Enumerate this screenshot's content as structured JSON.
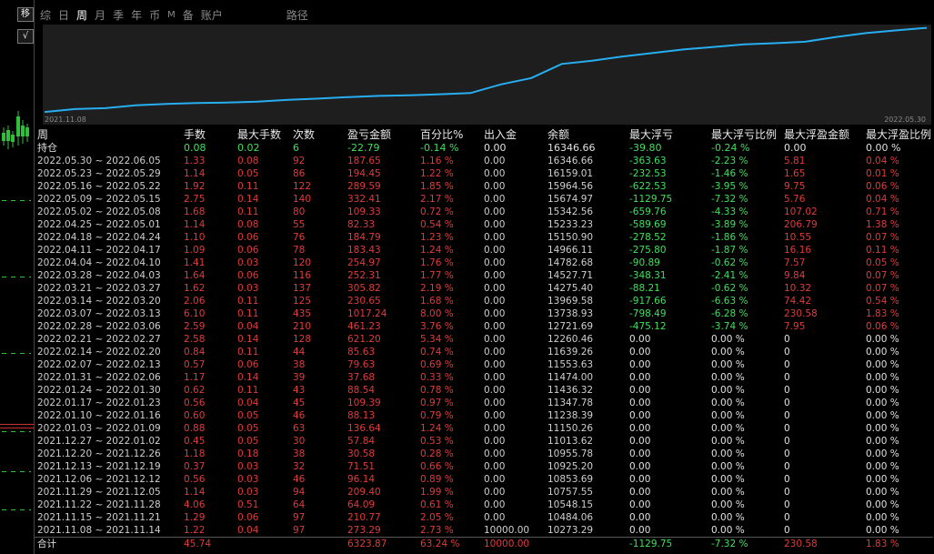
{
  "left_buttons": {
    "move": "移",
    "check": "√"
  },
  "tabs": [
    {
      "label": "综",
      "active": false,
      "small": false
    },
    {
      "label": "日",
      "active": false,
      "small": false
    },
    {
      "label": "周",
      "active": true,
      "small": false
    },
    {
      "label": "月",
      "active": false,
      "small": false
    },
    {
      "label": "季",
      "active": false,
      "small": false
    },
    {
      "label": "年",
      "active": false,
      "small": false
    },
    {
      "label": "币",
      "active": false,
      "small": false
    },
    {
      "label": "M",
      "active": false,
      "small": true
    },
    {
      "label": "备",
      "active": false,
      "small": false
    },
    {
      "label": "账户",
      "active": false,
      "small": false
    },
    {
      "label": "路径",
      "active": false,
      "small": false
    }
  ],
  "colors": {
    "positive": "#3ee05a",
    "negative": "#e23a3a",
    "line": "#27aef0",
    "panel": "#1e1e1e"
  },
  "chart_data": {
    "type": "line",
    "x_start_label": "2021.11.08",
    "x_end_label": "2022.05.30",
    "series": [
      {
        "values": [
          10273.29,
          10484.06,
          10548.15,
          10757.55,
          10853.69,
          10925.2,
          10955.78,
          11013.62,
          11150.26,
          11238.39,
          11347.78,
          11436.32,
          11474.0,
          11553.63,
          11639.26,
          12260.46,
          12721.69,
          13738.93,
          13969.58,
          14275.4,
          14527.71,
          14782.68,
          14966.11,
          15150.9,
          15233.23,
          15342.56,
          15674.97,
          15964.56,
          16159.01,
          16346.66
        ]
      }
    ],
    "ylim": [
      10150,
      16450
    ]
  },
  "table": {
    "headers": [
      "周",
      "手数",
      "最大手数",
      "次数",
      "盈亏金额",
      "百分比%",
      "出入金",
      "余额",
      "最大浮亏",
      "最大浮亏比例",
      "最大浮盈金额",
      "最大浮盈比例"
    ],
    "hold": {
      "label": "持仓",
      "lots": "0.08",
      "max_lots": "0.02",
      "count": "6",
      "pnl": "-22.79",
      "pct": "-0.14 %",
      "flow": "0.00",
      "balance": "16346.66",
      "max_dd": "-39.80",
      "max_dd_pct": "-0.24 %",
      "max_fp": "0.00",
      "max_fp_pct": "0.00 %"
    },
    "rows": [
      {
        "week": "2022.05.30 ~ 2022.06.05",
        "lots": "1.33",
        "max_lots": "0.08",
        "count": "92",
        "pnl": "187.65",
        "pct": "1.16 %",
        "flow": "0.00",
        "balance": "16346.66",
        "max_dd": "-363.63",
        "max_dd_pct": "-2.23 %",
        "max_fp": "5.81",
        "max_fp_pct": "0.04 %"
      },
      {
        "week": "2022.05.23 ~ 2022.05.29",
        "lots": "1.14",
        "max_lots": "0.05",
        "count": "86",
        "pnl": "194.45",
        "pct": "1.22 %",
        "flow": "0.00",
        "balance": "16159.01",
        "max_dd": "-232.53",
        "max_dd_pct": "-1.46 %",
        "max_fp": "1.65",
        "max_fp_pct": "0.01 %"
      },
      {
        "week": "2022.05.16 ~ 2022.05.22",
        "lots": "1.92",
        "max_lots": "0.11",
        "count": "122",
        "pnl": "289.59",
        "pct": "1.85 %",
        "flow": "0.00",
        "balance": "15964.56",
        "max_dd": "-622.53",
        "max_dd_pct": "-3.95 %",
        "max_fp": "9.75",
        "max_fp_pct": "0.06 %"
      },
      {
        "week": "2022.05.09 ~ 2022.05.15",
        "lots": "2.75",
        "max_lots": "0.14",
        "count": "140",
        "pnl": "332.41",
        "pct": "2.17 %",
        "flow": "0.00",
        "balance": "15674.97",
        "max_dd": "-1129.75",
        "max_dd_pct": "-7.32 %",
        "max_fp": "5.76",
        "max_fp_pct": "0.04 %"
      },
      {
        "week": "2022.05.02 ~ 2022.05.08",
        "lots": "1.68",
        "max_lots": "0.11",
        "count": "80",
        "pnl": "109.33",
        "pct": "0.72 %",
        "flow": "0.00",
        "balance": "15342.56",
        "max_dd": "-659.76",
        "max_dd_pct": "-4.33 %",
        "max_fp": "107.02",
        "max_fp_pct": "0.71 %"
      },
      {
        "week": "2022.04.25 ~ 2022.05.01",
        "lots": "1.14",
        "max_lots": "0.08",
        "count": "55",
        "pnl": "82.33",
        "pct": "0.54 %",
        "flow": "0.00",
        "balance": "15233.23",
        "max_dd": "-589.69",
        "max_dd_pct": "-3.89 %",
        "max_fp": "206.79",
        "max_fp_pct": "1.38 %"
      },
      {
        "week": "2022.04.18 ~ 2022.04.24",
        "lots": "1.10",
        "max_lots": "0.06",
        "count": "76",
        "pnl": "184.79",
        "pct": "1.23 %",
        "flow": "0.00",
        "balance": "15150.90",
        "max_dd": "-278.52",
        "max_dd_pct": "-1.86 %",
        "max_fp": "10.55",
        "max_fp_pct": "0.07 %"
      },
      {
        "week": "2022.04.11 ~ 2022.04.17",
        "lots": "1.09",
        "max_lots": "0.06",
        "count": "78",
        "pnl": "183.43",
        "pct": "1.24 %",
        "flow": "0.00",
        "balance": "14966.11",
        "max_dd": "-275.80",
        "max_dd_pct": "-1.87 %",
        "max_fp": "16.16",
        "max_fp_pct": "0.11 %"
      },
      {
        "week": "2022.04.04 ~ 2022.04.10",
        "lots": "1.41",
        "max_lots": "0.03",
        "count": "120",
        "pnl": "254.97",
        "pct": "1.76 %",
        "flow": "0.00",
        "balance": "14782.68",
        "max_dd": "-90.89",
        "max_dd_pct": "-0.62 %",
        "max_fp": "7.57",
        "max_fp_pct": "0.05 %"
      },
      {
        "week": "2022.03.28 ~ 2022.04.03",
        "lots": "1.64",
        "max_lots": "0.06",
        "count": "116",
        "pnl": "252.31",
        "pct": "1.77 %",
        "flow": "0.00",
        "balance": "14527.71",
        "max_dd": "-348.31",
        "max_dd_pct": "-2.41 %",
        "max_fp": "9.84",
        "max_fp_pct": "0.07 %"
      },
      {
        "week": "2022.03.21 ~ 2022.03.27",
        "lots": "1.62",
        "max_lots": "0.03",
        "count": "137",
        "pnl": "305.82",
        "pct": "2.19 %",
        "flow": "0.00",
        "balance": "14275.40",
        "max_dd": "-88.21",
        "max_dd_pct": "-0.62 %",
        "max_fp": "10.32",
        "max_fp_pct": "0.07 %"
      },
      {
        "week": "2022.03.14 ~ 2022.03.20",
        "lots": "2.06",
        "max_lots": "0.11",
        "count": "125",
        "pnl": "230.65",
        "pct": "1.68 %",
        "flow": "0.00",
        "balance": "13969.58",
        "max_dd": "-917.66",
        "max_dd_pct": "-6.63 %",
        "max_fp": "74.42",
        "max_fp_pct": "0.54 %"
      },
      {
        "week": "2022.03.07 ~ 2022.03.13",
        "lots": "6.10",
        "max_lots": "0.11",
        "count": "435",
        "pnl": "1017.24",
        "pct": "8.00 %",
        "flow": "0.00",
        "balance": "13738.93",
        "max_dd": "-798.49",
        "max_dd_pct": "-6.28 %",
        "max_fp": "230.58",
        "max_fp_pct": "1.83 %"
      },
      {
        "week": "2022.02.28 ~ 2022.03.06",
        "lots": "2.59",
        "max_lots": "0.04",
        "count": "210",
        "pnl": "461.23",
        "pct": "3.76 %",
        "flow": "0.00",
        "balance": "12721.69",
        "max_dd": "-475.12",
        "max_dd_pct": "-3.74 %",
        "max_fp": "7.95",
        "max_fp_pct": "0.06 %"
      },
      {
        "week": "2022.02.21 ~ 2022.02.27",
        "lots": "2.58",
        "max_lots": "0.14",
        "count": "128",
        "pnl": "621.20",
        "pct": "5.34 %",
        "flow": "0.00",
        "balance": "12260.46",
        "max_dd": "0.00",
        "max_dd_pct": "0.00 %",
        "max_fp": "0",
        "max_fp_pct": "0.00 %"
      },
      {
        "week": "2022.02.14 ~ 2022.02.20",
        "lots": "0.84",
        "max_lots": "0.11",
        "count": "44",
        "pnl": "85.63",
        "pct": "0.74 %",
        "flow": "0.00",
        "balance": "11639.26",
        "max_dd": "0.00",
        "max_dd_pct": "0.00 %",
        "max_fp": "0",
        "max_fp_pct": "0.00 %"
      },
      {
        "week": "2022.02.07 ~ 2022.02.13",
        "lots": "0.57",
        "max_lots": "0.06",
        "count": "38",
        "pnl": "79.63",
        "pct": "0.69 %",
        "flow": "0.00",
        "balance": "11553.63",
        "max_dd": "0.00",
        "max_dd_pct": "0.00 %",
        "max_fp": "0",
        "max_fp_pct": "0.00 %"
      },
      {
        "week": "2022.01.31 ~ 2022.02.06",
        "lots": "1.17",
        "max_lots": "0.14",
        "count": "39",
        "pnl": "37.68",
        "pct": "0.33 %",
        "flow": "0.00",
        "balance": "11474.00",
        "max_dd": "0.00",
        "max_dd_pct": "0.00 %",
        "max_fp": "0",
        "max_fp_pct": "0.00 %"
      },
      {
        "week": "2022.01.24 ~ 2022.01.30",
        "lots": "0.62",
        "max_lots": "0.11",
        "count": "43",
        "pnl": "88.54",
        "pct": "0.78 %",
        "flow": "0.00",
        "balance": "11436.32",
        "max_dd": "0.00",
        "max_dd_pct": "0.00 %",
        "max_fp": "0",
        "max_fp_pct": "0.00 %"
      },
      {
        "week": "2022.01.17 ~ 2022.01.23",
        "lots": "0.56",
        "max_lots": "0.04",
        "count": "45",
        "pnl": "109.39",
        "pct": "0.97 %",
        "flow": "0.00",
        "balance": "11347.78",
        "max_dd": "0.00",
        "max_dd_pct": "0.00 %",
        "max_fp": "0",
        "max_fp_pct": "0.00 %"
      },
      {
        "week": "2022.01.10 ~ 2022.01.16",
        "lots": "0.60",
        "max_lots": "0.05",
        "count": "46",
        "pnl": "88.13",
        "pct": "0.79 %",
        "flow": "0.00",
        "balance": "11238.39",
        "max_dd": "0.00",
        "max_dd_pct": "0.00 %",
        "max_fp": "0",
        "max_fp_pct": "0.00 %"
      },
      {
        "week": "2022.01.03 ~ 2022.01.09",
        "lots": "0.88",
        "max_lots": "0.05",
        "count": "63",
        "pnl": "136.64",
        "pct": "1.24 %",
        "flow": "0.00",
        "balance": "11150.26",
        "max_dd": "0.00",
        "max_dd_pct": "0.00 %",
        "max_fp": "0",
        "max_fp_pct": "0.00 %"
      },
      {
        "week": "2021.12.27 ~ 2022.01.02",
        "lots": "0.45",
        "max_lots": "0.05",
        "count": "30",
        "pnl": "57.84",
        "pct": "0.53 %",
        "flow": "0.00",
        "balance": "11013.62",
        "max_dd": "0.00",
        "max_dd_pct": "0.00 %",
        "max_fp": "0",
        "max_fp_pct": "0.00 %"
      },
      {
        "week": "2021.12.20 ~ 2021.12.26",
        "lots": "1.18",
        "max_lots": "0.18",
        "count": "38",
        "pnl": "30.58",
        "pct": "0.28 %",
        "flow": "0.00",
        "balance": "10955.78",
        "max_dd": "0.00",
        "max_dd_pct": "0.00 %",
        "max_fp": "0",
        "max_fp_pct": "0.00 %"
      },
      {
        "week": "2021.12.13 ~ 2021.12.19",
        "lots": "0.37",
        "max_lots": "0.03",
        "count": "32",
        "pnl": "71.51",
        "pct": "0.66 %",
        "flow": "0.00",
        "balance": "10925.20",
        "max_dd": "0.00",
        "max_dd_pct": "0.00 %",
        "max_fp": "0",
        "max_fp_pct": "0.00 %"
      },
      {
        "week": "2021.12.06 ~ 2021.12.12",
        "lots": "0.56",
        "max_lots": "0.03",
        "count": "46",
        "pnl": "96.14",
        "pct": "0.89 %",
        "flow": "0.00",
        "balance": "10853.69",
        "max_dd": "0.00",
        "max_dd_pct": "0.00 %",
        "max_fp": "0",
        "max_fp_pct": "0.00 %"
      },
      {
        "week": "2021.11.29 ~ 2021.12.05",
        "lots": "1.14",
        "max_lots": "0.03",
        "count": "94",
        "pnl": "209.40",
        "pct": "1.99 %",
        "flow": "0.00",
        "balance": "10757.55",
        "max_dd": "0.00",
        "max_dd_pct": "0.00 %",
        "max_fp": "0",
        "max_fp_pct": "0.00 %"
      },
      {
        "week": "2021.11.22 ~ 2021.11.28",
        "lots": "4.06",
        "max_lots": "0.51",
        "count": "64",
        "pnl": "64.09",
        "pct": "0.61 %",
        "flow": "0.00",
        "balance": "10548.15",
        "max_dd": "0.00",
        "max_dd_pct": "0.00 %",
        "max_fp": "0",
        "max_fp_pct": "0.00 %"
      },
      {
        "week": "2021.11.15 ~ 2021.11.21",
        "lots": "1.29",
        "max_lots": "0.06",
        "count": "97",
        "pnl": "210.77",
        "pct": "2.05 %",
        "flow": "0.00",
        "balance": "10484.06",
        "max_dd": "0.00",
        "max_dd_pct": "0.00 %",
        "max_fp": "0",
        "max_fp_pct": "0.00 %"
      },
      {
        "week": "2021.11.08 ~ 2021.11.14",
        "lots": "1.22",
        "max_lots": "0.04",
        "count": "97",
        "pnl": "273.29",
        "pct": "2.73 %",
        "flow": "10000.00",
        "balance": "10273.29",
        "max_dd": "0.00",
        "max_dd_pct": "0.00 %",
        "max_fp": "0",
        "max_fp_pct": "0.00 %"
      }
    ],
    "total": {
      "label": "合计",
      "lots": "45.74",
      "pnl": "6323.87",
      "pct": "63.24 %",
      "flow": "10000.00",
      "max_dd": "-1129.75",
      "max_dd_pct": "-7.32 %",
      "max_fp": "230.58",
      "max_fp_pct": "1.83 %"
    }
  }
}
